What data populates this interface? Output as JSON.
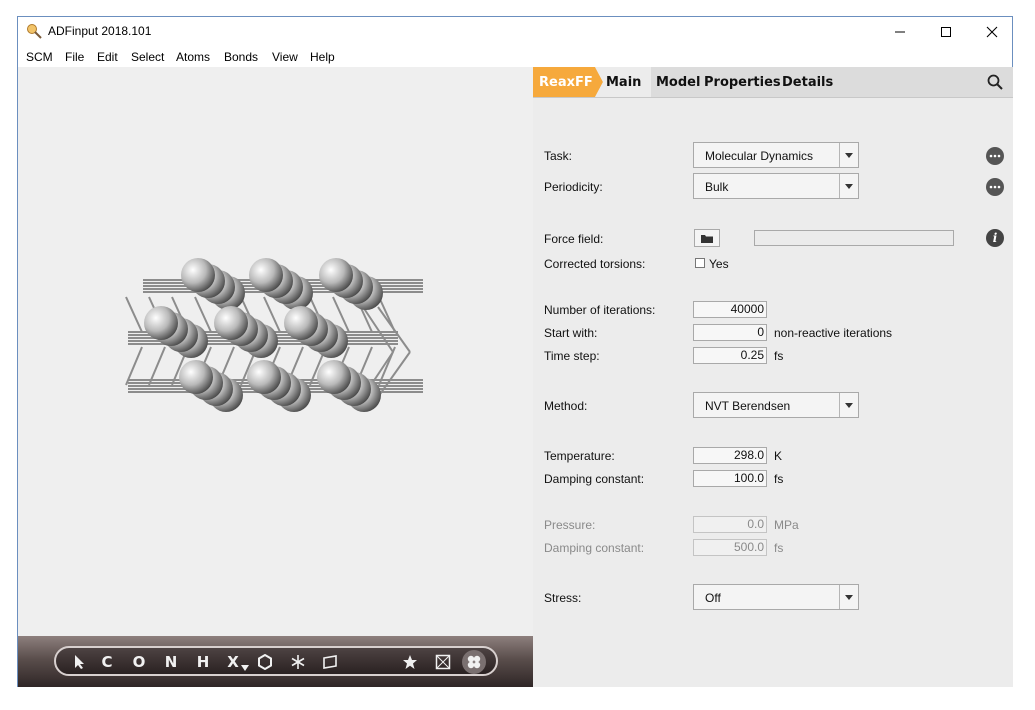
{
  "window": {
    "title": "ADFinput 2018.101"
  },
  "menu": [
    "SCM",
    "File",
    "Edit",
    "Select",
    "Atoms",
    "Bonds",
    "View",
    "Help"
  ],
  "tabs": {
    "reaxff": "ReaxFF",
    "main": "Main",
    "model": "Model",
    "properties": "Properties",
    "details": "Details"
  },
  "toolbar": [
    "C",
    "O",
    "N",
    "H",
    "X"
  ],
  "form": {
    "task": {
      "label": "Task:",
      "value": "Molecular Dynamics"
    },
    "periodicity": {
      "label": "Periodicity:",
      "value": "Bulk"
    },
    "force_field": {
      "label": "Force field:",
      "value": ""
    },
    "corrected_torsions": {
      "label": "Corrected torsions:",
      "option": "Yes",
      "checked": false
    },
    "iterations": {
      "label": "Number of iterations:",
      "value": "40000"
    },
    "start_with": {
      "label": "Start with:",
      "value": "0",
      "unit": "non-reactive iterations"
    },
    "time_step": {
      "label": "Time step:",
      "value": "0.25",
      "unit": "fs"
    },
    "method": {
      "label": "Method:",
      "value": "NVT Berendsen"
    },
    "temperature": {
      "label": "Temperature:",
      "value": "298.0",
      "unit": "K"
    },
    "damping1": {
      "label": "Damping constant:",
      "value": "100.0",
      "unit": "fs"
    },
    "pressure": {
      "label": "Pressure:",
      "value": "0.0",
      "unit": "MPa"
    },
    "damping2": {
      "label": "Damping constant:",
      "value": "500.0",
      "unit": "fs"
    },
    "stress": {
      "label": "Stress:",
      "value": "Off"
    }
  },
  "colors": {
    "accent": "#f6a93c",
    "panel": "#ececec",
    "viewport": "#efefef"
  }
}
